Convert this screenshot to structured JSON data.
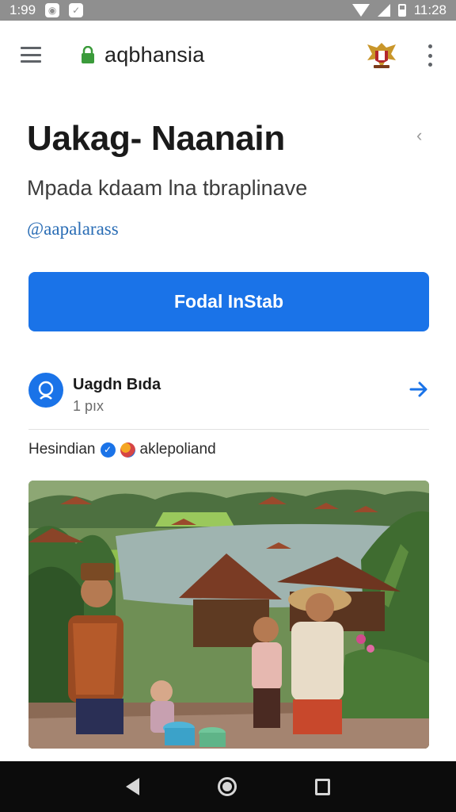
{
  "status_bar": {
    "time_left": "1:99",
    "time_right": "11:28",
    "icons": [
      "notification-icon",
      "message-icon",
      "wifi-icon",
      "signal-icon",
      "battery-icon"
    ]
  },
  "browser": {
    "url": "aqbhansia",
    "icons": [
      "menu-icon",
      "lock-icon",
      "emblem-icon",
      "more-options-icon"
    ],
    "lock_color": "#3b9b3b"
  },
  "page": {
    "title": "Uakag- Naanain",
    "subtitle": "Mpada kdaam lna tbraplinave",
    "handle": "@aapalarass",
    "primary_button": "Fodal InStab",
    "accent_color": "#1a73e8"
  },
  "profile": {
    "name": "Uagdn Bıda",
    "meta": "1 pıx"
  },
  "tag_row": {
    "label": "Hesindian",
    "sublabel": "aklepoliand"
  },
  "nav": {
    "icons": [
      "back-icon",
      "home-icon",
      "recents-icon"
    ]
  }
}
